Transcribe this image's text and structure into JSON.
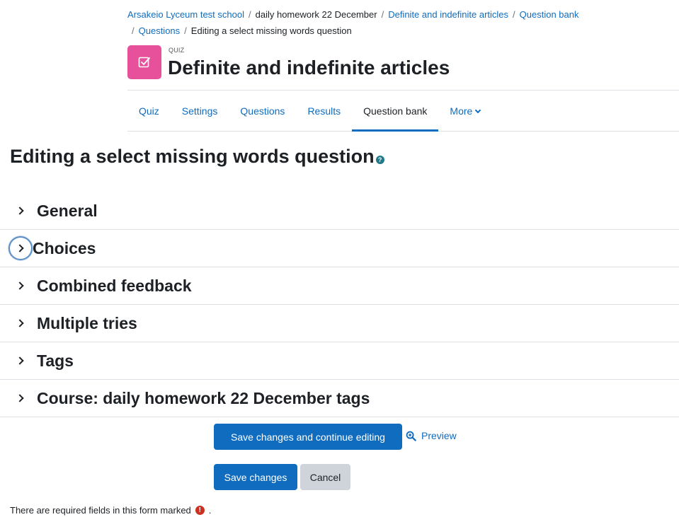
{
  "breadcrumb": [
    {
      "label": "Arsakeio Lyceum test school",
      "link": true
    },
    {
      "label": "daily homework 22 December",
      "link": false
    },
    {
      "label": "Definite and indefinite articles",
      "link": true
    },
    {
      "label": "Question bank",
      "link": true
    },
    {
      "label": "Questions",
      "link": true
    },
    {
      "label": "Editing a select missing words question",
      "link": false
    }
  ],
  "header": {
    "module_label": "QUIZ",
    "title": "Definite and indefinite articles",
    "icon": "quiz-checkbox-icon",
    "icon_color": "#e7519c"
  },
  "tabs": [
    {
      "label": "Quiz",
      "active": false
    },
    {
      "label": "Settings",
      "active": false
    },
    {
      "label": "Questions",
      "active": false
    },
    {
      "label": "Results",
      "active": false
    },
    {
      "label": "Question bank",
      "active": true
    },
    {
      "label": "More",
      "active": false
    }
  ],
  "page_heading": "Editing a select missing words question",
  "sections": [
    {
      "label": "General",
      "focused": false
    },
    {
      "label": "Choices",
      "focused": true
    },
    {
      "label": "Combined feedback",
      "focused": false
    },
    {
      "label": "Multiple tries",
      "focused": false
    },
    {
      "label": "Tags",
      "focused": false
    },
    {
      "label": "Course: daily homework 22 December tags",
      "focused": false
    }
  ],
  "buttons": {
    "save_continue": "Save changes and continue editing",
    "preview": "Preview",
    "save": "Save changes",
    "cancel": "Cancel"
  },
  "required_note": {
    "text": "There are required fields in this form marked",
    "suffix": "."
  },
  "colors": {
    "primary": "#0f6cbf",
    "required": "#ca3120",
    "text": "#1d2125"
  }
}
